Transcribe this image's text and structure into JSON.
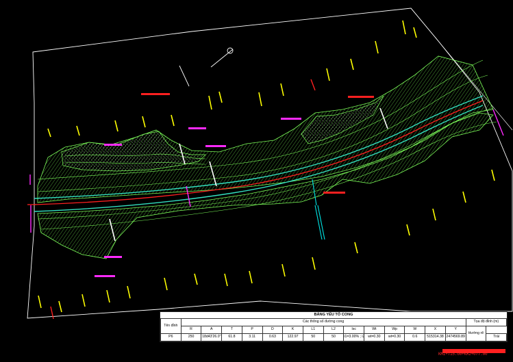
{
  "drawing": {
    "colors": {
      "background": "#000000",
      "boundary": "#ffffff",
      "terrain": "#7dff5a",
      "road_centerline": "#ff2020",
      "road_edge": "#33e0c0",
      "elevation_text": "#ffff00",
      "slope_text": "#ff2aff",
      "profile_marker": "#00e5e5"
    }
  },
  "table": {
    "title": "BẢNG YẾU TỐ CONG",
    "col_name": "Tên đỉnh",
    "group_params": "Các thông số đường cong",
    "group_coords": "Tọa độ đỉnh (m)",
    "col_direction": "Hướng rẽ",
    "headers": [
      "R",
      "A",
      "T",
      "P",
      "D",
      "K",
      "L1",
      "L2",
      "Isc",
      "Wt",
      "Wp",
      "W",
      "X",
      "Y"
    ],
    "row": {
      "name": "P6",
      "values": [
        "250",
        "18d43'26.0\"",
        "61.8",
        "3.11",
        "0.63",
        "122.97",
        "50",
        "50",
        "i1=3.00% ; i2=-3.00%",
        "wt=0.30",
        "wt=0.30",
        "0.6",
        "515314.38",
        "2474569.89"
      ],
      "direction": "Trái"
    }
  },
  "footer_code": "KM1+715.00+KM2+077.00"
}
